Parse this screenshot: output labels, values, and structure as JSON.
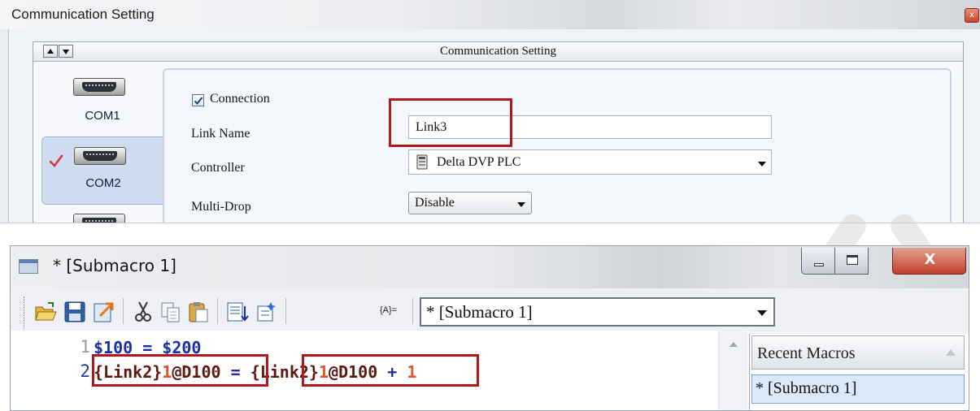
{
  "top_window": {
    "title": "Communication Setting",
    "close_glyph": "x",
    "panel_title": "Communication Setting",
    "ports": [
      {
        "label": "COM1",
        "selected": false
      },
      {
        "label": "COM2",
        "selected": true
      }
    ],
    "form": {
      "connection_label": "Connection",
      "connection_checked": true,
      "link_name_label": "Link Name",
      "link_name_value": "Link3",
      "controller_label": "Controller",
      "controller_value": "Delta DVP PLC",
      "multidrop_label": "Multi-Drop",
      "multidrop_value": "Disable"
    }
  },
  "bottom_window": {
    "title": "* [Submacro 1]",
    "close_glyph": "X",
    "toolbar": {
      "icons": [
        "open-folder-icon",
        "save-icon",
        "export-icon",
        "cut-icon",
        "copy-icon",
        "paste-icon",
        "insert-command-icon",
        "insert-function-icon",
        "variable-icon"
      ],
      "variable_label": "{A}=",
      "macro_select_value": "* [Submacro 1]"
    },
    "editor": {
      "line_numbers": [
        "1",
        "2"
      ],
      "line1": {
        "a": "$100",
        "op": " = ",
        "b": "$200"
      },
      "line2": {
        "lhs_link": "{Link2}",
        "lhs_num": "1",
        "lhs_at": "@",
        "lhs_reg": "D100",
        "eq": " = ",
        "rhs_link": "{Link2}",
        "rhs_num": "1",
        "rhs_at": "@",
        "rhs_reg": "D100",
        "plus": " + ",
        "const": "1"
      }
    },
    "recent_macros": {
      "title": "Recent Macros",
      "items": [
        "*  [Submacro 1]"
      ]
    }
  },
  "colors": {
    "highlight_red": "#b4171b",
    "code_blue": "#1d2fa8",
    "code_orange": "#e0532d",
    "code_brown": "#5c1a0e",
    "selection_blue": "#dbe8fa"
  }
}
